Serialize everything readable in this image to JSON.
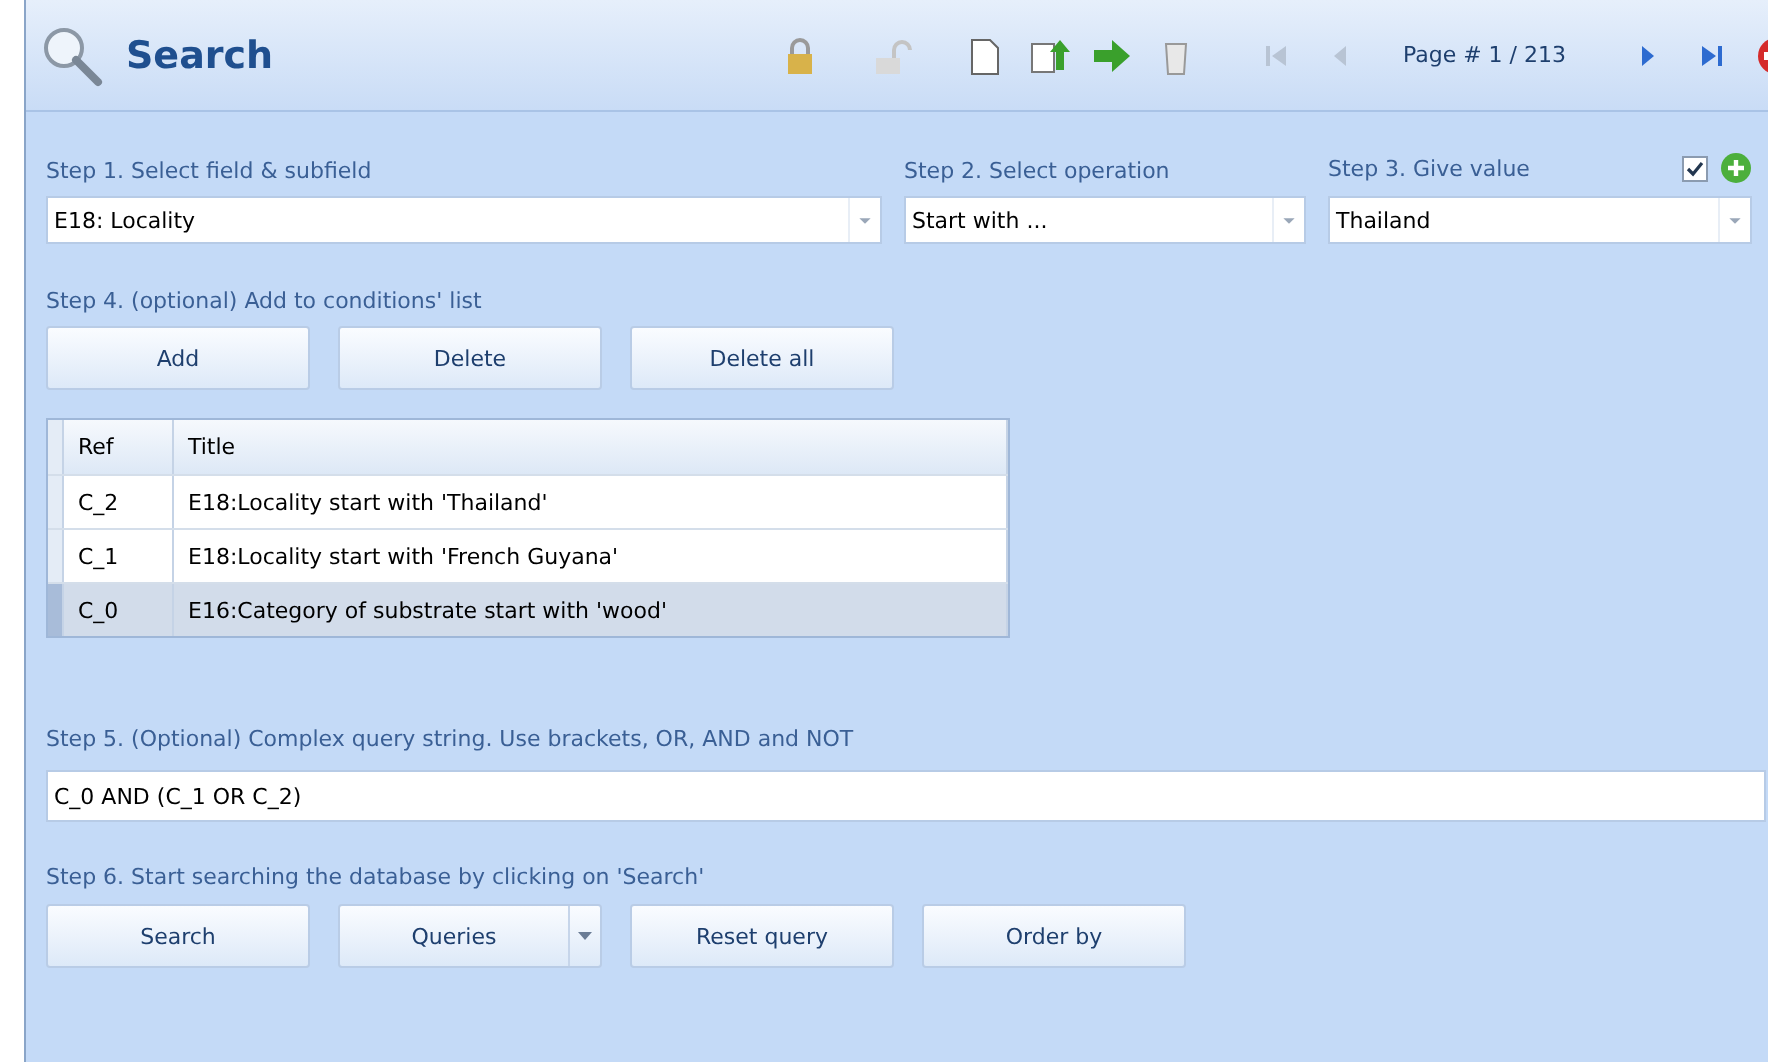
{
  "header": {
    "title": "Search",
    "page_label": "Page # 1 / 213"
  },
  "steps": {
    "step1": "Step 1. Select field & subfield",
    "step2": "Step 2. Select operation",
    "step3": "Step 3. Give value",
    "step4": "Step 4. (optional) Add to conditions' list",
    "step5": "Step 5. (Optional) Complex query string. Use brackets, OR, AND and NOT",
    "step6": "Step 6. Start searching the database by clicking on 'Search'"
  },
  "field_combo": {
    "value": "E18: Locality"
  },
  "operation_combo": {
    "value": "Start with ..."
  },
  "value_combo": {
    "value": "Thailand"
  },
  "use_value_checkbox": {
    "checked": true
  },
  "condition_buttons": [
    "Add",
    "Delete",
    "Delete all"
  ],
  "table": {
    "columns": [
      "Ref",
      "Title"
    ],
    "rows": [
      {
        "ref": "C_2",
        "title": "E18:Locality start with 'Thailand'",
        "selected": false
      },
      {
        "ref": "C_1",
        "title": "E18:Locality start with 'French Guyana'",
        "selected": false
      },
      {
        "ref": "C_0",
        "title": "E16:Category of substrate start with 'wood'",
        "selected": true
      }
    ]
  },
  "query_field": {
    "value": "C_0 AND (C_1 OR C_2)"
  },
  "action_buttons": [
    {
      "label": "Search",
      "kind": "plain"
    },
    {
      "label": "Queries",
      "kind": "split"
    },
    {
      "label": "Reset query",
      "kind": "plain"
    },
    {
      "label": "Order by",
      "kind": "plain"
    }
  ]
}
